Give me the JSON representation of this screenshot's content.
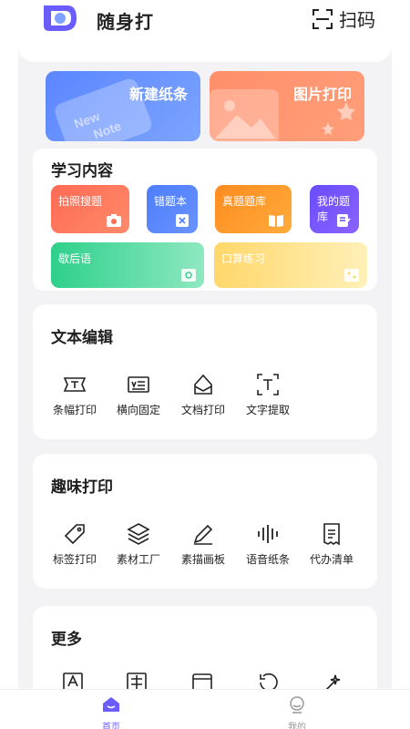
{
  "header": {
    "app_name": "随身打",
    "scan_label": "扫码"
  },
  "quick_actions": [
    {
      "label": "新建纸条",
      "icon": "note-icon",
      "color": "#5b86ff"
    },
    {
      "label": "图片打印",
      "icon": "image-icon",
      "color": "#ff8f6b"
    }
  ],
  "learning": {
    "title": "学习内容",
    "tiles": [
      {
        "label": "拍照搜题",
        "icon": "camera-icon",
        "color": "#ff6a53"
      },
      {
        "label": "错题本",
        "icon": "wrong-book-icon",
        "color": "#4c7dfc"
      },
      {
        "label": "真题题库",
        "icon": "book-icon",
        "color": "#ff8b1f"
      },
      {
        "label": "我的题库",
        "icon": "my-bank-icon",
        "color": "#6a4cff"
      },
      {
        "label": "歇后语",
        "icon": "phrase-icon",
        "color": "#2ed08b"
      },
      {
        "label": "口算练习",
        "icon": "calc-icon",
        "color": "#ffd76a"
      }
    ]
  },
  "text_edit": {
    "title": "文本编辑",
    "tools": [
      {
        "label": "条幅打印",
        "icon": "banner-icon"
      },
      {
        "label": "横向固定",
        "icon": "horizontal-icon"
      },
      {
        "label": "文档打印",
        "icon": "document-icon"
      },
      {
        "label": "文字提取",
        "icon": "text-extract-icon"
      }
    ]
  },
  "fun_print": {
    "title": "趣味打印",
    "tools": [
      {
        "label": "标签打印",
        "icon": "tag-icon"
      },
      {
        "label": "素材工厂",
        "icon": "layers-icon"
      },
      {
        "label": "素描画板",
        "icon": "pencil-icon"
      },
      {
        "label": "语音纸条",
        "icon": "voice-icon"
      },
      {
        "label": "代办清单",
        "icon": "checklist-icon"
      }
    ]
  },
  "more": {
    "title": "更多"
  },
  "nav": [
    {
      "label": "首页",
      "icon": "home-icon",
      "active": true
    },
    {
      "label": "我的",
      "icon": "profile-icon",
      "active": false
    }
  ],
  "colors": {
    "accent": "#6a5cff"
  }
}
